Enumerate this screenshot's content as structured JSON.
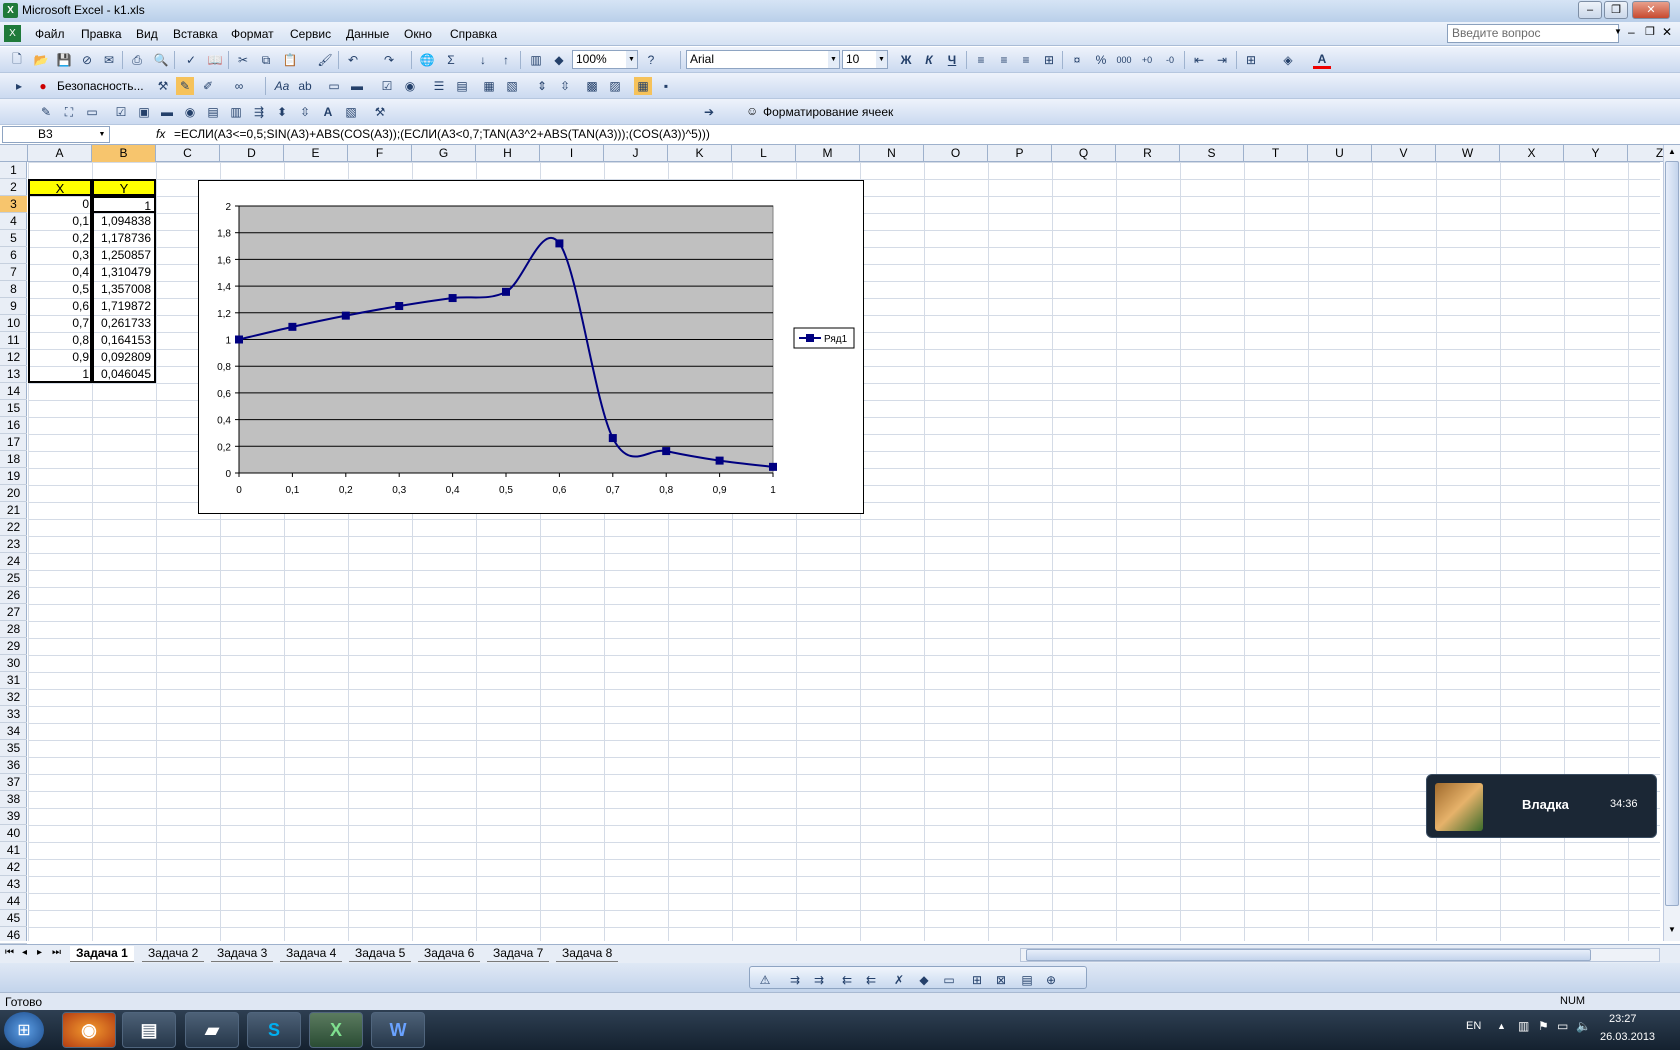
{
  "window": {
    "title": "Microsoft Excel - k1.xls"
  },
  "menu": [
    "Файл",
    "Правка",
    "Вид",
    "Вставка",
    "Формат",
    "Сервис",
    "Данные",
    "Окно",
    "Справка"
  ],
  "help_placeholder": "Введите вопрос",
  "toolbar": {
    "zoom": "100%",
    "font": "Arial",
    "size": "10",
    "security_label": "Безопасность...",
    "format_cells_label": "Форматирование ячеек",
    "bold": "Ж",
    "italic": "К",
    "underline": "Ч"
  },
  "formula_bar": {
    "name_box": "B3",
    "fx": "fx",
    "formula": "=ЕСЛИ(A3<=0,5;SIN(A3)+ABS(COS(A3));(ЕСЛИ(A3<0,7;TAN(A3^2+ABS(TAN(A3)));(COS(A3))^5)))"
  },
  "columns": [
    "A",
    "B",
    "C",
    "D",
    "E",
    "F",
    "G",
    "H",
    "I",
    "J",
    "K",
    "L",
    "M",
    "N",
    "O",
    "P",
    "Q",
    "R",
    "S",
    "T",
    "U",
    "V",
    "W",
    "X",
    "Y",
    "Z"
  ],
  "rows": [
    "1",
    "2",
    "3",
    "4",
    "5",
    "6",
    "7",
    "8",
    "9",
    "10",
    "11",
    "12",
    "13",
    "14",
    "15",
    "16",
    "17",
    "18",
    "19",
    "20",
    "21",
    "22",
    "23",
    "24",
    "25",
    "26",
    "27",
    "28",
    "29",
    "30",
    "31",
    "32",
    "33",
    "34",
    "35",
    "36",
    "37",
    "38",
    "39",
    "40",
    "41",
    "42",
    "43",
    "44",
    "45",
    "46"
  ],
  "table": {
    "header_x": "X",
    "header_y": "Y",
    "x": [
      "0",
      "0,1",
      "0,2",
      "0,3",
      "0,4",
      "0,5",
      "0,6",
      "0,7",
      "0,8",
      "0,9",
      "1"
    ],
    "y": [
      "1",
      "1,094838",
      "1,178736",
      "1,250857",
      "1,310479",
      "1,357008",
      "1,719872",
      "0,261733",
      "0,164153",
      "0,092809",
      "0,046045"
    ]
  },
  "chart_data": {
    "type": "line",
    "x": [
      0,
      0.1,
      0.2,
      0.3,
      0.4,
      0.5,
      0.6,
      0.7,
      0.8,
      0.9,
      1
    ],
    "x_tick_labels": [
      "0",
      "0,1",
      "0,2",
      "0,3",
      "0,4",
      "0,5",
      "0,6",
      "0,7",
      "0,8",
      "0,9",
      "1"
    ],
    "y_tick_labels": [
      "0",
      "0,2",
      "0,4",
      "0,6",
      "0,8",
      "1",
      "1,2",
      "1,4",
      "1,6",
      "1,8",
      "2"
    ],
    "ylim": [
      0,
      2
    ],
    "series": [
      {
        "name": "Ряд1",
        "values": [
          1,
          1.094838,
          1.178736,
          1.250857,
          1.310479,
          1.357008,
          1.719872,
          0.261733,
          0.164153,
          0.092809,
          0.046045
        ]
      }
    ],
    "legend": "right",
    "grid": true,
    "plot_bg": "#c0c0c0",
    "line_color": "#000080"
  },
  "sheets": [
    "Задача 1",
    "Задача 2",
    "Задача 3",
    "Задача 4",
    "Задача 5",
    "Задача 6",
    "Задача 7",
    "Задача 8"
  ],
  "status": {
    "ready": "Готово",
    "num": "NUM"
  },
  "notification": {
    "name": "Владка",
    "time": "34:36"
  },
  "taskbar": {
    "lang": "EN",
    "clock_time": "23:27",
    "clock_date": "26.03.2013"
  }
}
